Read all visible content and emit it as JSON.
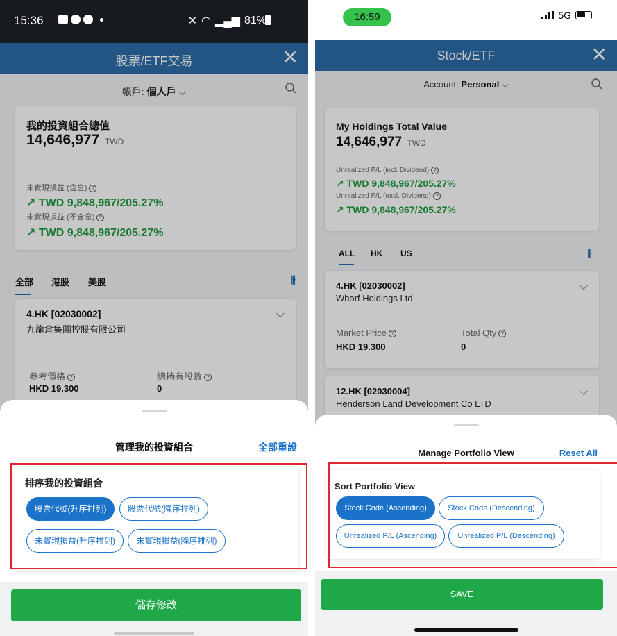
{
  "left": {
    "status": {
      "time": "15:36",
      "battery": "81%"
    },
    "header": {
      "title": "股票/ETF交易",
      "close": "✕"
    },
    "account": {
      "label": "帳戶:",
      "value": "個人戶"
    },
    "summary": {
      "title": "我的投資組合總值",
      "total": "14,646,977",
      "currency": "TWD",
      "pl_incl_label": "未實現損益 (含息)",
      "pl_incl_value": "TWD 9,848,967/205.27%",
      "pl_excl_label": "未實現損益 (不含息)",
      "pl_excl_value": "TWD 9,848,967/205.27%"
    },
    "tabs": [
      "全部",
      "港股",
      "美股"
    ],
    "stock": {
      "code": "4.HK [02030002]",
      "name": "九龍倉集團控股有限公司",
      "price_label": "參考價格",
      "price_value": "HKD 19.300",
      "qty_label": "總持有股數",
      "qty_value": "0"
    },
    "sheet": {
      "title": "管理我的投資組合",
      "reset": "全部重設",
      "sort_title": "排序我的投資組合",
      "options": [
        "股票代號(升序排列)",
        "股票代號(降序排列)",
        "未實現損益(升序排列)",
        "未實現損益(降序排列)"
      ],
      "save": "儲存修改"
    }
  },
  "right": {
    "status": {
      "time": "16:59",
      "network": "5G"
    },
    "header": {
      "title": "Stock/ETF",
      "close": "✕"
    },
    "account": {
      "label": "Account:",
      "value": "Personal"
    },
    "summary": {
      "title": "My Holdings Total Value",
      "total": "14,646,977",
      "currency": "TWD",
      "pl_incl_label": "Unrealized P/L (incl. Dividend)",
      "pl_incl_value": "TWD 9,848,967/205.27%",
      "pl_excl_label": "Unrealized P/L (excl. Dividend)",
      "pl_excl_value": "TWD 9,848,967/205.27%"
    },
    "tabs": [
      "ALL",
      "HK",
      "US"
    ],
    "stock": {
      "code": "4.HK [02030002]",
      "name": "Wharf Holdings Ltd",
      "price_label": "Market Price",
      "price_value": "HKD 19.300",
      "qty_label": "Total Qty",
      "qty_value": "0"
    },
    "stock2": {
      "code": "12.HK [02030004]",
      "name": "Henderson Land Development Co LTD"
    },
    "sheet": {
      "title": "Manage Portfolio View",
      "reset": "Reset All",
      "sort_title": "Sort Portfolio View",
      "options": [
        "Stock Code (Ascending)",
        "Stock Code (Descending)",
        "Unrealized P/L (Ascending)",
        "Unrealized P/L (Descending)"
      ],
      "save": "SAVE"
    }
  },
  "colors": {
    "header": "#2c6da9",
    "accent": "#1a73c9",
    "positive": "#1f9d3f",
    "save": "#1fa847",
    "highlight": "#e0262b"
  },
  "icons": [
    "search-icon",
    "close-icon",
    "chevron-down-icon",
    "filter-icon",
    "trend-up-icon",
    "help-icon"
  ]
}
